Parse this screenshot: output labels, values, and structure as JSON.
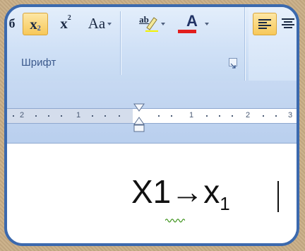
{
  "toolbar": {
    "font_group_label": "Шрифт",
    "subscript_label": "x",
    "subscript_small": "2",
    "superscript_label": "x",
    "superscript_small": "2",
    "change_case_label": "Aa",
    "highlight_label": "ab",
    "font_color_label": "A",
    "font_color": "#e21e1e"
  },
  "ruler": {
    "ticks": [
      "2",
      "1",
      "1",
      "2",
      "3"
    ]
  },
  "document": {
    "text_main": "X1→x",
    "text_sub": "1"
  },
  "colors": {
    "accent": "#3b69ad",
    "ribbon": "#d7e6f8"
  }
}
